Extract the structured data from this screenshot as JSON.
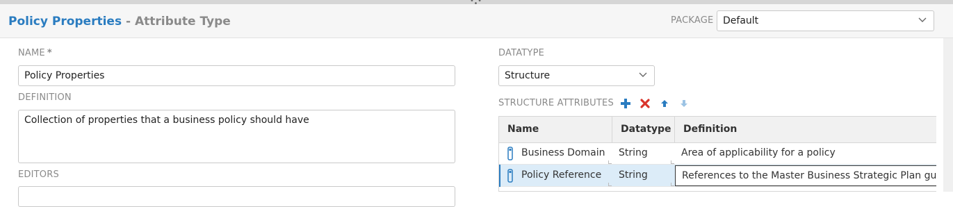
{
  "header": {
    "title": "Policy Properties",
    "subtitle": "- Attribute Type",
    "package_label": "PACKAGE",
    "package_value": "Default"
  },
  "form": {
    "name_label": "NAME",
    "name_required": "*",
    "name_value": "Policy Properties",
    "definition_label": "DEFINITION",
    "definition_value": "Collection of properties that a business policy should have",
    "editors_label": "EDITORS",
    "datatype_label": "DATATYPE",
    "datatype_value": "Structure",
    "structure_label": "STRUCTURE ATTRIBUTES"
  },
  "toolbar_icons": [
    "plus-icon",
    "delete-x-icon",
    "arrow-up-icon",
    "arrow-down-icon"
  ],
  "grid": {
    "columns": [
      "Name",
      "Datatype",
      "Definition"
    ],
    "rows": [
      {
        "name": "Business Domain",
        "datatype": "String",
        "definition": "Area of applicability for a policy",
        "selected": false
      },
      {
        "name": "Policy Reference",
        "datatype": "String",
        "definition": "References to the Master Business Strategic Plan guid",
        "selected": true
      }
    ]
  },
  "colors": {
    "accent": "#2a7cc0",
    "muted": "#8a8a8a",
    "selected_row": "#dcecf8",
    "delete": "#d9342b"
  }
}
